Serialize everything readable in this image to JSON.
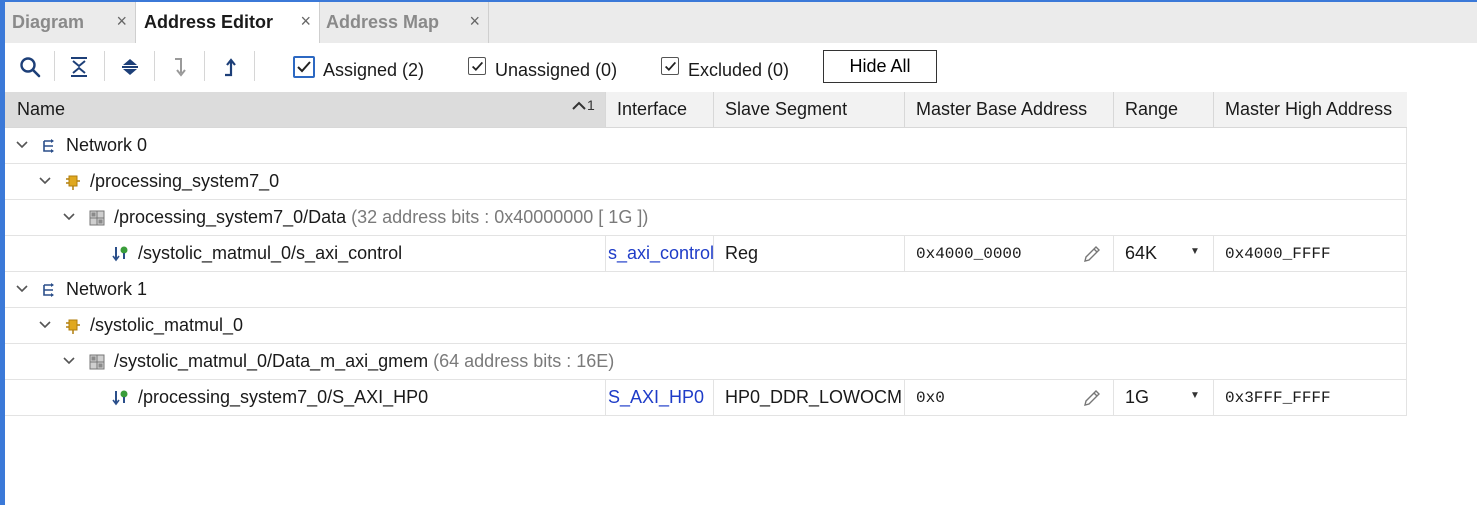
{
  "tabs": [
    {
      "label": "Diagram",
      "close": "×"
    },
    {
      "label": "Address Editor",
      "close": "×"
    },
    {
      "label": "Address Map",
      "close": "×"
    }
  ],
  "toolbar": {
    "icons": [
      "search-icon",
      "collapse-all-icon",
      "expand-all-icon",
      "step-into-icon",
      "step-out-icon"
    ],
    "checkboxes": [
      {
        "label": "Assigned (2)",
        "checked": true
      },
      {
        "label": "Unassigned (0)",
        "checked": true
      },
      {
        "label": "Excluded (0)",
        "checked": true
      }
    ],
    "hide_all": "Hide All"
  },
  "columns": {
    "name": "Name",
    "sort_indicator": "1",
    "interface": "Interface",
    "slave_segment": "Slave Segment",
    "master_base": "Master Base Address",
    "range": "Range",
    "master_high": "Master High Address"
  },
  "rows": [
    {
      "type": "network",
      "name": "Network 0"
    },
    {
      "type": "cell",
      "name": "/processing_system7_0"
    },
    {
      "type": "space",
      "name": "/processing_system7_0/Data",
      "hint": "(32 address bits : 0x40000000 [ 1G ])"
    },
    {
      "type": "segment",
      "name": "/systolic_matmul_0/s_axi_control",
      "interface": "s_axi_control",
      "slave_segment": "Reg",
      "master_base": "0x4000_0000",
      "range": "64K",
      "master_high": "0x4000_FFFF"
    },
    {
      "type": "network",
      "name": "Network 1"
    },
    {
      "type": "cell",
      "name": "/systolic_matmul_0"
    },
    {
      "type": "space",
      "name": "/systolic_matmul_0/Data_m_axi_gmem",
      "hint": "(64 address bits : 16E)"
    },
    {
      "type": "segment",
      "name": "/processing_system7_0/S_AXI_HP0",
      "interface": "S_AXI_HP0",
      "slave_segment": "HP0_DDR_LOWOCM",
      "master_base": "0x0",
      "range": "1G",
      "master_high": "0x3FFF_FFFF"
    }
  ],
  "colors": {
    "accent": "#3b79d8",
    "interface_link": "#1e3cc8",
    "ip_icon": "#d9a21b",
    "segment_icon": "#3a9d3a"
  }
}
